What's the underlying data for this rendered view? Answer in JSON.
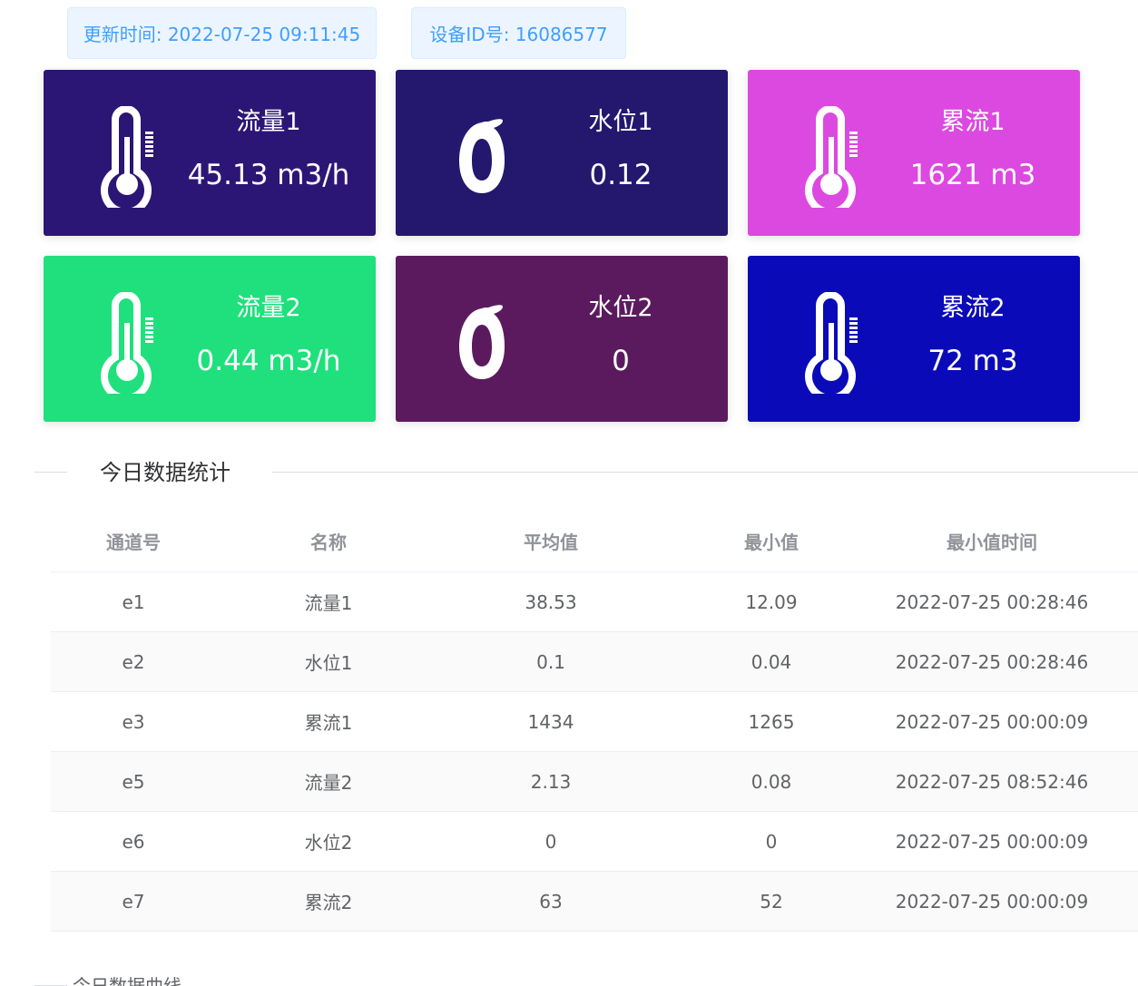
{
  "info": {
    "update_time": "更新时间: 2022-07-25 09:11:45",
    "device_id": "设备ID号: 16086577"
  },
  "cards": [
    {
      "label": "流量1",
      "value": "45.13 m3/h",
      "icon": "thermometer-icon",
      "color": "#2c1675"
    },
    {
      "label": "水位1",
      "value": "0.12",
      "icon": "ring-icon",
      "color": "#23176e"
    },
    {
      "label": "累流1",
      "value": "1621 m3",
      "icon": "thermometer-icon",
      "color": "#dc49e0"
    },
    {
      "label": "流量2",
      "value": "0.44 m3/h",
      "icon": "thermometer-icon",
      "color": "#1fe07c"
    },
    {
      "label": "水位2",
      "value": "0",
      "icon": "ring-icon",
      "color": "#5b1a5e"
    },
    {
      "label": "累流2",
      "value": "72 m3",
      "icon": "thermometer-icon",
      "color": "#0b0ab8"
    }
  ],
  "stats": {
    "title": "今日数据统计",
    "columns": [
      "通道号",
      "名称",
      "平均值",
      "最小值",
      "最小值时间"
    ],
    "rows": [
      [
        "e1",
        "流量1",
        "38.53",
        "12.09",
        "2022-07-25 00:28:46"
      ],
      [
        "e2",
        "水位1",
        "0.1",
        "0.04",
        "2022-07-25 00:28:46"
      ],
      [
        "e3",
        "累流1",
        "1434",
        "1265",
        "2022-07-25 00:00:09"
      ],
      [
        "e5",
        "流量2",
        "2.13",
        "0.08",
        "2022-07-25 08:52:46"
      ],
      [
        "e6",
        "水位2",
        "0",
        "0",
        "2022-07-25 00:00:09"
      ],
      [
        "e7",
        "累流2",
        "63",
        "52",
        "2022-07-25 00:00:09"
      ]
    ]
  },
  "curve": {
    "title": "今日数据曲线"
  }
}
